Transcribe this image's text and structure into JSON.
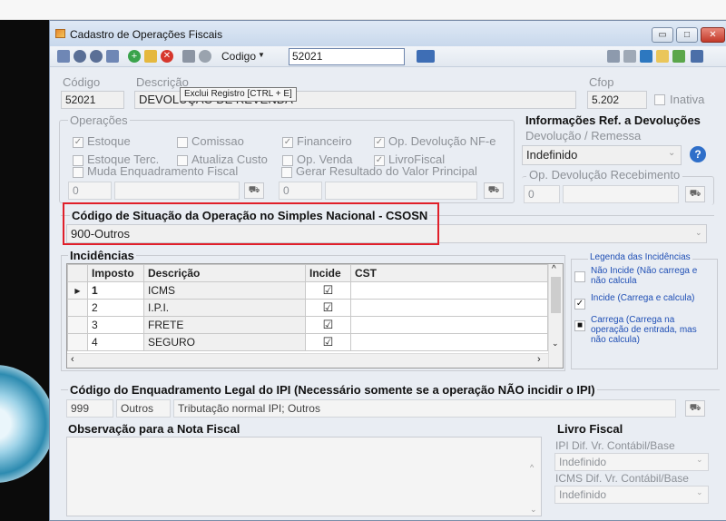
{
  "window": {
    "title": "Cadastro de Operações Fiscais"
  },
  "toolbar": {
    "search_field_label": "Codigo",
    "search_value": "52021"
  },
  "tooltip": "Exclui Registro [CTRL + E]",
  "header": {
    "codigo_label": "Código",
    "codigo_value": "52021",
    "descricao_label": "Descrição",
    "descricao_value": "DEVOLUÇÃO DE REVENDA",
    "cfop_label": "Cfop",
    "cfop_value": "5.202",
    "inativa_label": "Inativa"
  },
  "operacoes": {
    "title": "Operações",
    "checks": [
      {
        "label": "Estoque",
        "checked": true
      },
      {
        "label": "Comissao",
        "checked": false
      },
      {
        "label": "Financeiro",
        "checked": true
      },
      {
        "label": "Op. Devolução NF-e",
        "checked": true
      },
      {
        "label": "Estoque Terc.",
        "checked": false
      },
      {
        "label": "Atualiza Custo",
        "checked": false
      },
      {
        "label": "Op. Venda",
        "checked": false
      },
      {
        "label": "LivroFiscal",
        "checked": true
      }
    ],
    "muda_label": "Muda Enquadramento Fiscal",
    "muda_value": "0",
    "gerar_label": "Gerar Resultado do Valor Principal",
    "gerar_value": "0"
  },
  "devolucoes": {
    "title": "Informações Ref. a Devoluções",
    "sub_label": "Devolução / Remessa",
    "select_value": "Indefinido",
    "help_icon": "?",
    "receb_label": "Op. Devolução Recebimento",
    "receb_value": "0"
  },
  "csosn": {
    "title": "Código de Situação da Operação no Simples Nacional - CSOSN",
    "value": "900-Outros"
  },
  "incidencias": {
    "title": "Incidências",
    "columns": [
      "Imposto",
      "Descrição",
      "Incide",
      "CST"
    ],
    "rows": [
      {
        "imposto": "1",
        "descricao": "ICMS",
        "incide": "☑",
        "cst": ""
      },
      {
        "imposto": "2",
        "descricao": "I.P.I.",
        "incide": "☑",
        "cst": ""
      },
      {
        "imposto": "3",
        "descricao": "FRETE",
        "incide": "☑",
        "cst": ""
      },
      {
        "imposto": "4",
        "descricao": "SEGURO",
        "incide": "☑",
        "cst": ""
      }
    ]
  },
  "legenda": {
    "title": "Legenda das Incidências",
    "items": [
      {
        "text": "Não Incide (Não carrega e não calcula",
        "mark": ""
      },
      {
        "text": "Incide (Carrega e calcula)",
        "mark": "✓"
      },
      {
        "text": "Carrega (Carrega na operação de entrada, mas não calcula)",
        "mark": "■"
      }
    ]
  },
  "ipi": {
    "title": "Código do Enquadramento Legal do IPI (Necessário somente se a operação NÃO incidir o IPI)",
    "code": "999",
    "group": "Outros",
    "description": "Tributação normal IPI; Outros"
  },
  "observacao": {
    "title": "Observação para a Nota Fiscal"
  },
  "livro": {
    "title": "Livro Fiscal",
    "ipi_label": "IPI Dif. Vr. Contábil/Base",
    "ipi_value": "Indefinido",
    "icms_label": "ICMS Dif. Vr. Contábil/Base",
    "icms_value": "Indefinido"
  },
  "colors": {
    "highlight": "#e01f2a",
    "link_blue": "#1f4fb5",
    "help_blue": "#2f6fc9"
  }
}
